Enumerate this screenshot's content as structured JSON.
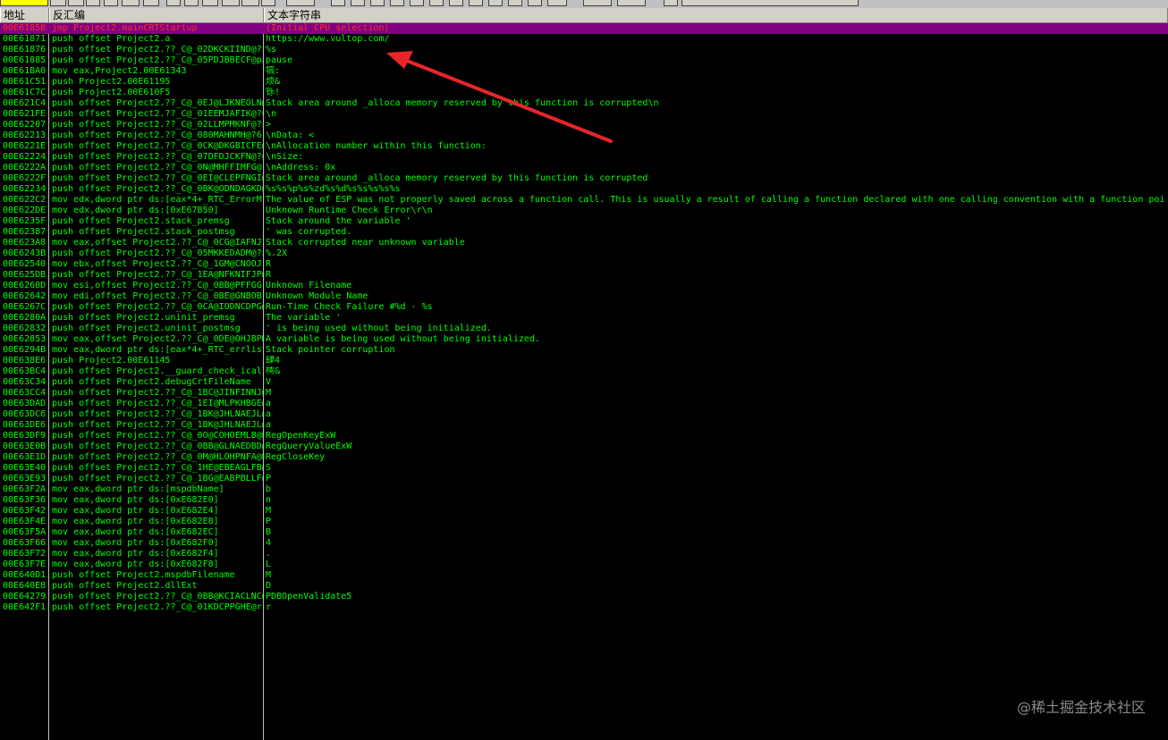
{
  "columns": {
    "addr": "地址",
    "disasm": "反汇编",
    "string": "文本字符串"
  },
  "rows": [
    {
      "addr": "00E6185B",
      "disasm": "jmp Project2.mainCRTStartup",
      "string": "(Initial CPU selection)",
      "selected": true
    },
    {
      "addr": "00E61871",
      "disasm": "push offset Project2.a",
      "string": "https://www.vultop.com/"
    },
    {
      "addr": "00E61876",
      "disasm": "push offset Project2.??_C@_02DKCKIIND@?$CFs",
      "string": "%s"
    },
    {
      "addr": "00E61885",
      "disasm": "push offset Project2.??_C@_05PDJBBECF@pause",
      "string": "pause"
    },
    {
      "addr": "00E61BA0",
      "disasm": "mov eax,Project2.00E61343",
      "string": "犒:"
    },
    {
      "addr": "00E61C51",
      "disasm": "push Project2.00E61195",
      "string": "烦&"
    },
    {
      "addr": "00E61C7C",
      "disasm": "push Project2.00E610F5",
      "string": "铄!"
    },
    {
      "addr": "00E621C4",
      "disasm": "push offset Project2.??_C@_0EJ@LJKNEOLN@",
      "string": "Stack area around _alloca memory reserved by this function is corrupted\\n"
    },
    {
      "addr": "00E621FE",
      "disasm": "push offset Project2.??_C@_01EEMJAFIK@?6",
      "string": "\\n"
    },
    {
      "addr": "00E62207",
      "disasm": "push offset Project2.??_C@_02LLMPMKNF@?$",
      "string": ">"
    },
    {
      "addr": "00E62213",
      "disasm": "push offset Project2.??_C@_080MAHNMH@?6",
      "string": "\\nData: <"
    },
    {
      "addr": "00E6221E",
      "disasm": "push offset Project2.??_C@_0CK@DKGBICFE@",
      "string": "\\nAllocation number within this function:"
    },
    {
      "addr": "00E62224",
      "disasm": "push offset Project2.??_C@_07DFDJCKFN@?6",
      "string": "\\nSize:"
    },
    {
      "addr": "00E6222A",
      "disasm": "push offset Project2.??_C@_0N@MHFFIMFG@?",
      "string": "\\nAddress: 0x"
    },
    {
      "addr": "00E6222F",
      "disasm": "push offset Project2.??_C@_0EI@CLEPFNGI@",
      "string": "Stack area around _alloca memory reserved by this function is corrupted"
    },
    {
      "addr": "00E62234",
      "disasm": "push offset Project2.??_C@_0BK@ODNDAGKD@",
      "string": "%s%s%p%s%zd%s%d%s%s%s%s%s"
    },
    {
      "addr": "00E622C2",
      "disasm": "mov edx,dword ptr ds:[eax*4+_RTC_ErrorM",
      "string": "The value of ESP was not properly saved across a function call.  This is usually a result of calling a function declared with one calling convention with a function poi"
    },
    {
      "addr": "00E622DE",
      "disasm": "mov edx,dword ptr ds:[0xE67B50]",
      "string": "Unknown Runtime Check Error\\r\\n"
    },
    {
      "addr": "00E6235F",
      "disasm": "push offset Project2.stack_premsg",
      "string": "Stack around the variable '"
    },
    {
      "addr": "00E62387",
      "disasm": "push offset Project2.stack_postmsg",
      "string": "' was corrupted."
    },
    {
      "addr": "00E623A8",
      "disasm": "mov eax,offset Project2.??_C@_0CG@IAFNJI",
      "string": "Stack corrupted near unknown variable"
    },
    {
      "addr": "00E6243B",
      "disasm": "push offset Project2.??_C@_05MKKEDADM@?$",
      "string": "%.2X"
    },
    {
      "addr": "00E62540",
      "disasm": "mov ebx,offset Project2.??_C@_1GM@CNOOJ",
      "string": "R"
    },
    {
      "addr": "00E625DB",
      "disasm": "push offset Project2.??_C@_1EA@NFKNIFJP@",
      "string": "R"
    },
    {
      "addr": "00E6260D",
      "disasm": "mov esi,offset Project2.??_C@_0BB@PFFGG",
      "string": "Unknown Filename"
    },
    {
      "addr": "00E62642",
      "disasm": "mov edi,offset Project2.??_C@_0BE@GNBOBI",
      "string": "Unknown Module Name"
    },
    {
      "addr": "00E6267C",
      "disasm": "push offset Project2.??_C@_0CA@IODNCDPG@",
      "string": "Run-Time Check Failure #%d - %s"
    },
    {
      "addr": "00E6280A",
      "disasm": "push offset Project2.uninit_premsg",
      "string": "The variable '"
    },
    {
      "addr": "00E62832",
      "disasm": "push offset Project2.uninit_postmsg",
      "string": "' is being used without being initialized."
    },
    {
      "addr": "00E62853",
      "disasm": "mov eax,offset Project2.??_C@_0DE@OHJBPM",
      "string": "A variable is being used without being initialized."
    },
    {
      "addr": "00E6294B",
      "disasm": "mov eax,dword ptr ds:[eax*4+_RTC_errlist",
      "string": "Stack pointer corruption"
    },
    {
      "addr": "00E638E6",
      "disasm": "push Project2.00E61145",
      "string": "肆4"
    },
    {
      "addr": "00E63BC4",
      "disasm": "push offset Project2.__guard_check_icall",
      "string": "樗&"
    },
    {
      "addr": "00E63C34",
      "disasm": "push offset Project2.debugCrtFileName",
      "string": "V"
    },
    {
      "addr": "00E63CC4",
      "disasm": "push offset Project2.??_C@_1BC@JINFINNJ@",
      "string": "M"
    },
    {
      "addr": "00E63DAD",
      "disasm": "push offset Project2.??_C@_1EI@MLPKHBGE@",
      "string": "a"
    },
    {
      "addr": "00E63DC6",
      "disasm": "push offset Project2.??_C@_1BK@JHLNAEJL@",
      "string": "a"
    },
    {
      "addr": "00E63DE6",
      "disasm": "push offset Project2.??_C@_1BK@JHLNAEJL@",
      "string": "a"
    },
    {
      "addr": "00E63DF9",
      "disasm": "push offset Project2.??_C@_0O@COHOEMLB@R",
      "string": "RegOpenKeyExW"
    },
    {
      "addr": "00E63E0B",
      "disasm": "push offset Project2.??_C@_0BB@GLNAEDBD@",
      "string": "RegQueryValueExW"
    },
    {
      "addr": "00E63E1D",
      "disasm": "push offset Project2.??_C@_0M@HLOHPNFA@R",
      "string": "RegCloseKey"
    },
    {
      "addr": "00E63E40",
      "disasm": "push offset Project2.??_C@_1HE@EBEAGLFB@",
      "string": "S"
    },
    {
      "addr": "00E63E93",
      "disasm": "push offset Project2.??_C@_1BG@EABPBLLF@",
      "string": "P"
    },
    {
      "addr": "00E63F2A",
      "disasm": "mov eax,dword ptr ds:[mspdbName]",
      "string": "b"
    },
    {
      "addr": "00E63F36",
      "disasm": "mov eax,dword ptr ds:[0xE682E0]",
      "string": "n"
    },
    {
      "addr": "00E63F42",
      "disasm": "mov eax,dword ptr ds:[0xE682E4]",
      "string": "M"
    },
    {
      "addr": "00E63F4E",
      "disasm": "mov eax,dword ptr ds:[0xE682E8]",
      "string": "P"
    },
    {
      "addr": "00E63F5A",
      "disasm": "mov eax,dword ptr ds:[0xE682EC]",
      "string": "B"
    },
    {
      "addr": "00E63F66",
      "disasm": "mov eax,dword ptr ds:[0xE682F0]",
      "string": "4"
    },
    {
      "addr": "00E63F72",
      "disasm": "mov eax,dword ptr ds:[0xE682F4]",
      "string": "."
    },
    {
      "addr": "00E63F7E",
      "disasm": "mov eax,dword ptr ds:[0xE682F8]",
      "string": "L"
    },
    {
      "addr": "00E640D1",
      "disasm": "push offset Project2.mspdbFilename",
      "string": "M"
    },
    {
      "addr": "00E640E8",
      "disasm": "push offset Project2.dllExt",
      "string": "D"
    },
    {
      "addr": "00E64279",
      "disasm": "push offset Project2.??_C@_0BB@KCIACLNC@",
      "string": "PDBOpenValidate5"
    },
    {
      "addr": "00E642F1",
      "disasm": "push offset Project2.??_C@_01KDCPPGHE@r",
      "string": "r"
    }
  ],
  "watermark": "@稀土掘金技术社区",
  "colors": {
    "background": "#000000",
    "text": "#00ff00",
    "selected_bg": "#800080",
    "selected_text": "#ff3030",
    "arrow": "#e8262a"
  },
  "annotation_icon": "red-arrow-icon"
}
